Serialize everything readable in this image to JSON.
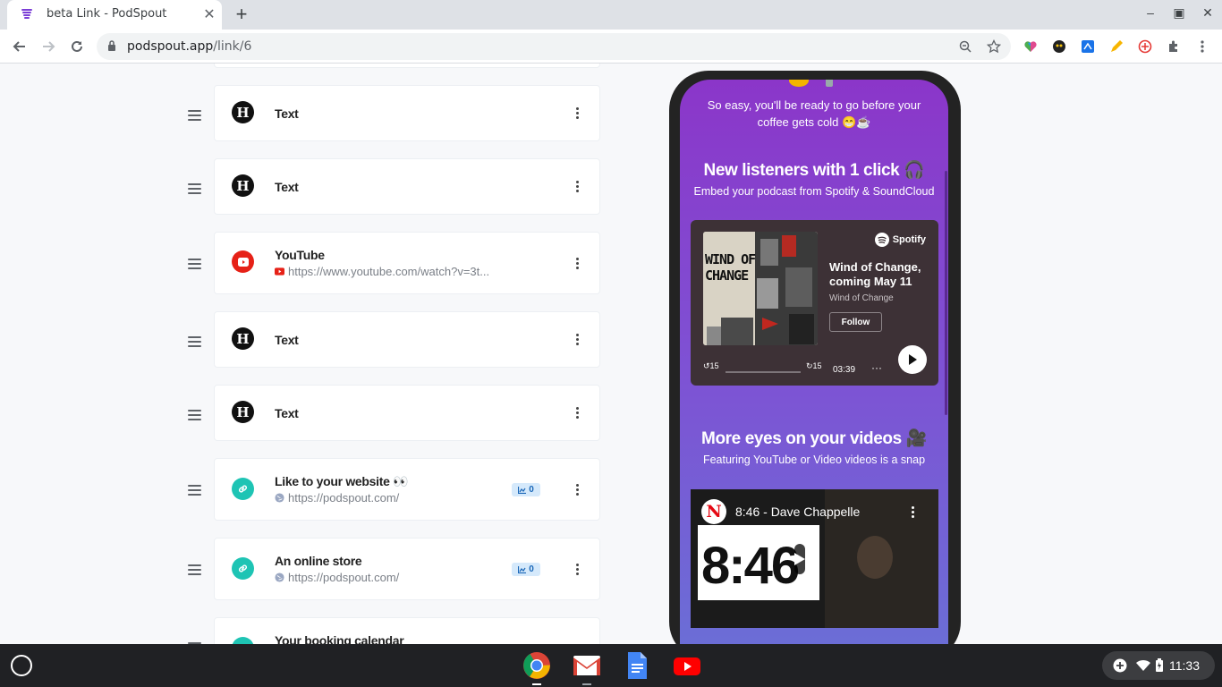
{
  "browser": {
    "tab_title": "beta Link - PodSpout",
    "url_domain": "podspout.app",
    "url_path": "/link/6"
  },
  "links": [
    {
      "type": "text",
      "title": "Text"
    },
    {
      "type": "text",
      "title": "Text"
    },
    {
      "type": "youtube",
      "title": "YouTube",
      "url": "https://www.youtube.com/watch?v=3t..."
    },
    {
      "type": "text",
      "title": "Text"
    },
    {
      "type": "text",
      "title": "Text"
    },
    {
      "type": "link",
      "title": "Like to your website 👀",
      "url": "https://podspout.com/",
      "clicks": "0"
    },
    {
      "type": "link",
      "title": "An online store",
      "url": "https://podspout.com/",
      "clicks": "0"
    },
    {
      "type": "link",
      "title": "Your booking calendar"
    }
  ],
  "preview": {
    "intro": "So easy, you'll be ready to go before your coffee gets cold 😁☕",
    "section1_title": "New listeners with 1 click 🎧",
    "section1_sub": "Embed your podcast from Spotify & SoundCloud",
    "spotify": {
      "brand": "Spotify",
      "episode_title": "Wind of Change, coming May 11",
      "show_name": "Wind of Change",
      "follow_label": "Follow",
      "time": "03:39",
      "album_text": "WIND OF CHANGE",
      "skip_back": "15",
      "skip_fwd": "15",
      "more": "···"
    },
    "section2_title": "More eyes on your videos 🎥",
    "section2_sub": "Featuring YouTube or Video videos is a snap",
    "youtube": {
      "video_title": "8:46 - Dave Chappelle",
      "thumb_text": "8:46",
      "channel_initial": "N"
    }
  },
  "system": {
    "clock": "11:33"
  },
  "colors": {
    "accent_purple": "#8b36c9",
    "link_teal": "#1ec4b4",
    "youtube_red": "#e62117"
  }
}
